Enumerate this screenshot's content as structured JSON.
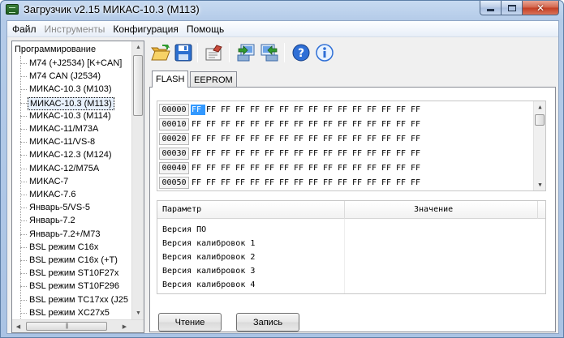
{
  "window": {
    "title": "Загрузчик v2.15 МИКАС-10.3 (M113)"
  },
  "menu": [
    "Файл",
    "Инструменты",
    "Конфигурация",
    "Помощь"
  ],
  "menu_disabled": [
    false,
    true,
    false,
    false
  ],
  "tree": {
    "root": "Программирование",
    "items": [
      "M74 (+J2534) [K+CAN]",
      "M74 CAN (J2534)",
      "МИКАС-10.3 (M103)",
      "МИКАС-10.3 (M113)",
      "МИКАС-10.3 (M114)",
      "МИКАС-11/M73A",
      "МИКАС-11/VS-8",
      "МИКАС-12.3 (M124)",
      "МИКАС-12/M75A",
      "МИКАС-7",
      "МИКАС-7.6",
      "Январь-5/VS-5",
      "Январь-7.2",
      "Январь-7.2+/M73",
      "BSL режим C16x",
      "BSL режим C16x (+T)",
      "BSL режим ST10F27x",
      "BSL режим ST10F296",
      "BSL режим TC17xx (J25",
      "BSL режим XC27x5"
    ],
    "selected_index": 3
  },
  "toolbar": {
    "icons": [
      "open-folder-icon",
      "save-disk-icon",
      "settings-check-icon",
      "download-ecu-icon",
      "upload-ecu-icon",
      "help-icon",
      "info-icon"
    ]
  },
  "tabs": [
    {
      "label": "FLASH",
      "active": true
    },
    {
      "label": "EEPROM",
      "active": false
    }
  ],
  "hex": {
    "rows": [
      {
        "addr": "00000",
        "bytes": [
          "FF",
          "FF",
          "FF",
          "FF",
          "FF",
          "FF",
          "FF",
          "FF",
          "FF",
          "FF",
          "FF",
          "FF",
          "FF",
          "FF",
          "FF",
          "FF"
        ]
      },
      {
        "addr": "00010",
        "bytes": [
          "FF",
          "FF",
          "FF",
          "FF",
          "FF",
          "FF",
          "FF",
          "FF",
          "FF",
          "FF",
          "FF",
          "FF",
          "FF",
          "FF",
          "FF",
          "FF"
        ]
      },
      {
        "addr": "00020",
        "bytes": [
          "FF",
          "FF",
          "FF",
          "FF",
          "FF",
          "FF",
          "FF",
          "FF",
          "FF",
          "FF",
          "FF",
          "FF",
          "FF",
          "FF",
          "FF",
          "FF"
        ]
      },
      {
        "addr": "00030",
        "bytes": [
          "FF",
          "FF",
          "FF",
          "FF",
          "FF",
          "FF",
          "FF",
          "FF",
          "FF",
          "FF",
          "FF",
          "FF",
          "FF",
          "FF",
          "FF",
          "FF"
        ]
      },
      {
        "addr": "00040",
        "bytes": [
          "FF",
          "FF",
          "FF",
          "FF",
          "FF",
          "FF",
          "FF",
          "FF",
          "FF",
          "FF",
          "FF",
          "FF",
          "FF",
          "FF",
          "FF",
          "FF"
        ]
      },
      {
        "addr": "00050",
        "bytes": [
          "FF",
          "FF",
          "FF",
          "FF",
          "FF",
          "FF",
          "FF",
          "FF",
          "FF",
          "FF",
          "FF",
          "FF",
          "FF",
          "FF",
          "FF",
          "FF"
        ]
      }
    ],
    "selected": {
      "row": 0,
      "col": 0
    }
  },
  "params": {
    "header": {
      "name": "Параметр",
      "value": "Значение"
    },
    "rows": [
      {
        "name": "Версия ПО",
        "value": ""
      },
      {
        "name": "Версия калибровок 1",
        "value": ""
      },
      {
        "name": "Версия калибровок 2",
        "value": ""
      },
      {
        "name": "Версия калибровок 3",
        "value": ""
      },
      {
        "name": "Версия калибровок 4",
        "value": ""
      }
    ]
  },
  "buttons": {
    "read": "Чтение",
    "write": "Запись"
  }
}
